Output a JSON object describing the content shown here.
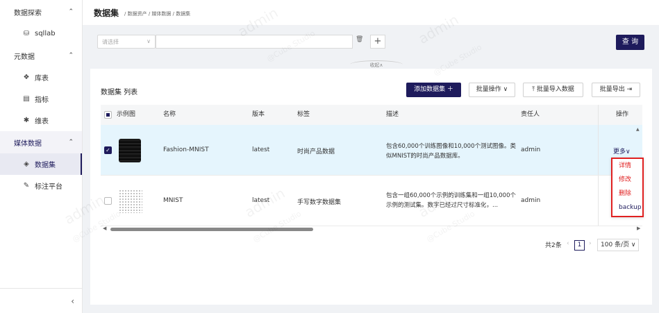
{
  "sidebar": {
    "groups": [
      {
        "label": "数据探索",
        "items": [
          {
            "label": "sqllab",
            "icon": "database-icon"
          }
        ]
      },
      {
        "label": "元数据",
        "items": [
          {
            "label": "库表",
            "icon": "cube-icon"
          },
          {
            "label": "指标",
            "icon": "chart-icon"
          },
          {
            "label": "维表",
            "icon": "box-icon"
          }
        ]
      },
      {
        "label": "媒体数据",
        "items": [
          {
            "label": "数据集",
            "icon": "layers-icon"
          },
          {
            "label": "标注平台",
            "icon": "edit-icon"
          }
        ]
      }
    ],
    "collapse_icon": "‹"
  },
  "header": {
    "title": "数据集",
    "breadcrumb": "/ 数据资产 / 媒体数据 / 数据集"
  },
  "filter": {
    "select_placeholder": "请选择",
    "query_button": "查 询",
    "collapse_label": "收起∧"
  },
  "list": {
    "title": "数据集 列表",
    "add_button": "添加数据集 ＋",
    "batch_ops": "批量操作 ∨",
    "batch_import": "批量导入数据",
    "batch_export": "批量导出"
  },
  "table": {
    "columns": [
      "示例图",
      "名称",
      "版本",
      "标签",
      "描述",
      "责任人",
      "操作"
    ],
    "rows": [
      {
        "name": "Fashion-MNIST",
        "version": "latest",
        "tag": "时尚产品数据",
        "desc": "包含60,000个训练图像和10,000个测试图像。类似MNIST的时尚产品数据库。",
        "owner": "admin",
        "action": "更多∨",
        "checked": true
      },
      {
        "name": "MNIST",
        "version": "latest",
        "tag": "手写数字数据集",
        "desc": "包含一组60,000个示例的训练集和一组10,000个示例的测试集。数字已经过尺寸标准化，...",
        "owner": "admin",
        "action": "",
        "checked": false
      }
    ]
  },
  "dropdown": {
    "items": [
      "详情",
      "修改",
      "删除",
      "backup"
    ]
  },
  "pagination": {
    "total": "共2条",
    "current": "1",
    "page_size": "100 条/页 ∨"
  },
  "colors": {
    "brand": "#1e1b5c",
    "highlight_row": "#e5f5fd",
    "dropdown_border": "#e02020"
  }
}
